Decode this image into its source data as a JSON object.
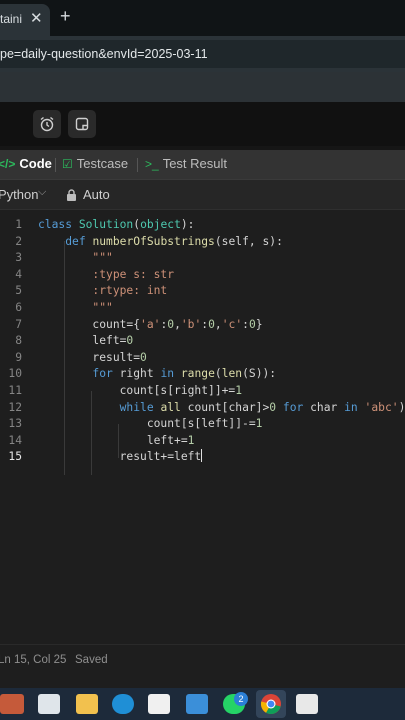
{
  "browser": {
    "tab_title": "taini",
    "tab_close": "✕",
    "new_tab": "+",
    "url": "pe=daily-question&envId=2025-03-11"
  },
  "panel_tabs": [
    {
      "label": "Code",
      "icon": "code-icon"
    },
    {
      "label": "Testcase",
      "icon": "checkbox-icon"
    },
    {
      "label": "Test Result",
      "icon": "terminal-icon"
    }
  ],
  "language": {
    "label": "Python",
    "mode": "Auto"
  },
  "editor": {
    "line_numbers": [
      "1",
      "2",
      "3",
      "4",
      "5",
      "6",
      "7",
      "8",
      "9",
      "10",
      "11",
      "12",
      "13",
      "14",
      "15"
    ]
  },
  "status": {
    "cursor": "Ln 15, Col 25",
    "saved": "Saved"
  },
  "taskbar": {
    "badge_count": "2"
  },
  "colors": {
    "accent_green": "#2cbb5d",
    "keyword_blue": "#569cd6",
    "string_orange": "#ce9178"
  }
}
